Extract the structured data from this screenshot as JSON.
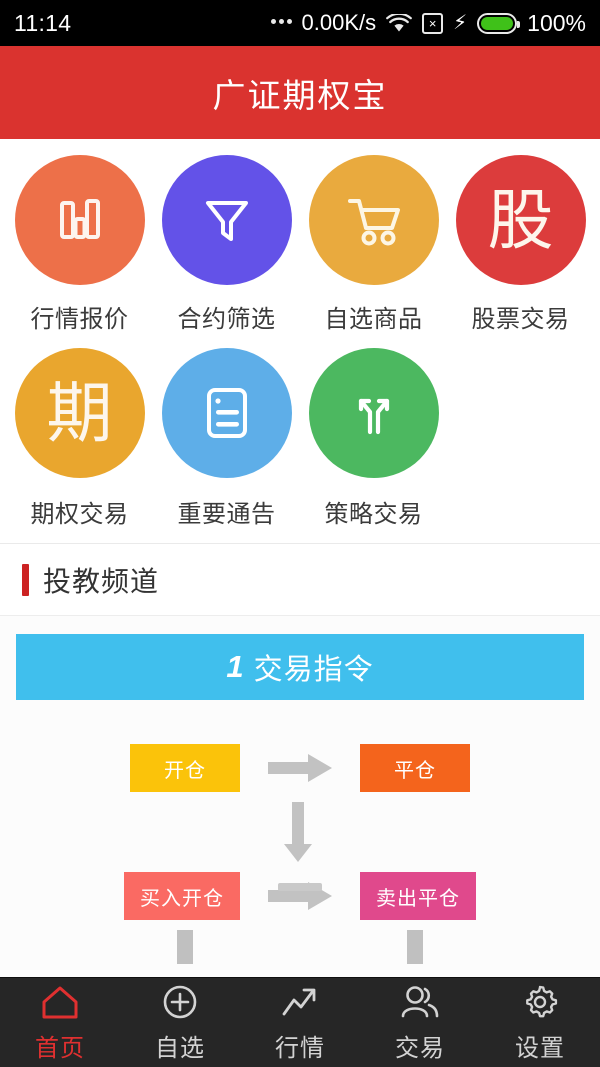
{
  "statusbar": {
    "time": "11:14",
    "dots_icon": "more-dots-icon",
    "net_speed": "0.00K/s",
    "wifi_icon": "wifi-icon",
    "x_icon": "x-box-icon",
    "charging_icon": "charging-bolt-icon",
    "battery_icon": "battery-icon",
    "battery_percent": "100%"
  },
  "header": {
    "title": "广证期权宝"
  },
  "grid": {
    "rows": [
      [
        {
          "label": "行情报价",
          "icon": "bar-chart-icon",
          "color": "#ed7049",
          "glyph": ""
        },
        {
          "label": "合约筛选",
          "icon": "funnel-filter-icon",
          "color": "#6352e8",
          "glyph": ""
        },
        {
          "label": "自选商品",
          "icon": "shopping-cart-icon",
          "color": "#e9aa3e",
          "glyph": ""
        },
        {
          "label": "股票交易",
          "icon": "stock-char-icon",
          "color": "#dc3c3c",
          "glyph": "股"
        }
      ],
      [
        {
          "label": "期权交易",
          "icon": "option-char-icon",
          "color": "#e9a62e",
          "glyph": "期"
        },
        {
          "label": "重要通告",
          "icon": "document-notice-icon",
          "color": "#5eaee8",
          "glyph": ""
        },
        {
          "label": "策略交易",
          "icon": "fork-arrows-icon",
          "color": "#4cb860",
          "glyph": ""
        }
      ]
    ]
  },
  "section": {
    "title": "投教频道",
    "accent_color": "#cc2222"
  },
  "banner": {
    "number": "1",
    "text": "交易指令",
    "color": "#40bfed"
  },
  "flow": {
    "row1": {
      "left": {
        "label": "开仓",
        "color": "#fbc30a"
      },
      "right": {
        "label": "平仓",
        "color": "#f4641c"
      }
    },
    "row2": {
      "left": {
        "label": "买入开仓",
        "color": "#fa6a63"
      },
      "right": {
        "label": "卖出平仓",
        "color": "#e0498c"
      }
    },
    "arrow_icon": "arrow-right-icon",
    "down_arrow_icon": "arrow-down-icon",
    "connector_icon": "connector-stub-icon"
  },
  "tabbar": {
    "items": [
      {
        "label": "首页",
        "icon": "home-icon",
        "active": true
      },
      {
        "label": "自选",
        "icon": "plus-circle-icon",
        "active": false
      },
      {
        "label": "行情",
        "icon": "trend-arrow-icon",
        "active": false
      },
      {
        "label": "交易",
        "icon": "people-icon",
        "active": false
      },
      {
        "label": "设置",
        "icon": "gear-icon",
        "active": false
      }
    ],
    "active_color": "#e03030"
  }
}
